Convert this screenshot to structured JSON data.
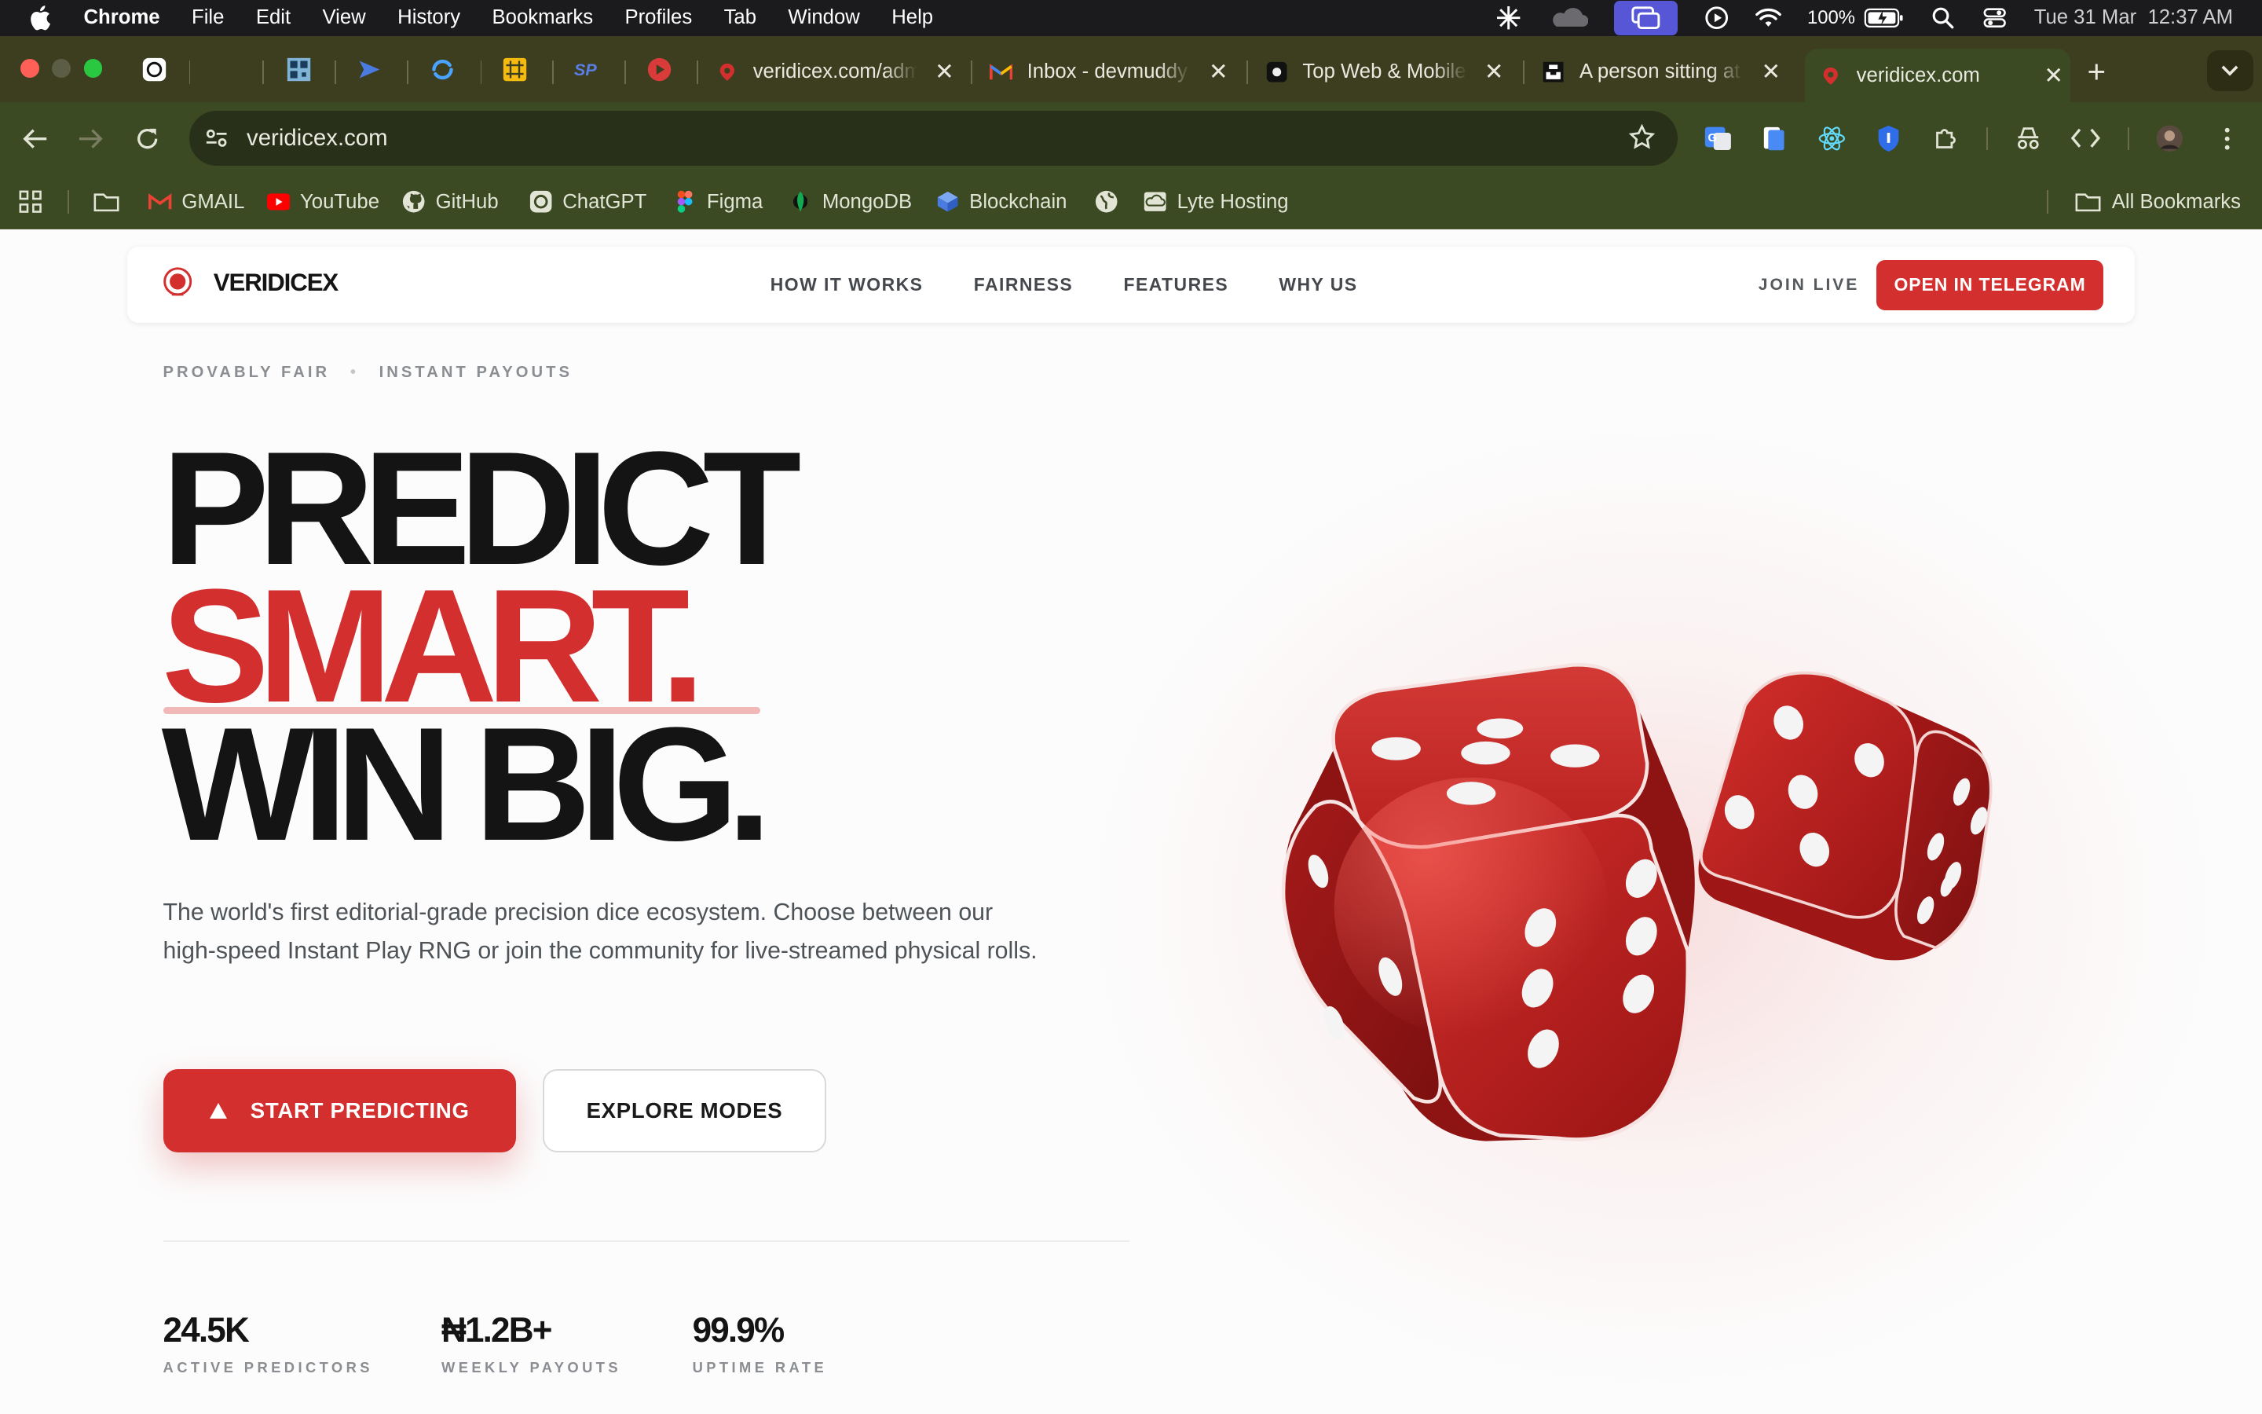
{
  "menubar": {
    "app": "Chrome",
    "items": [
      "File",
      "Edit",
      "View",
      "History",
      "Bookmarks",
      "Profiles",
      "Tab",
      "Window",
      "Help"
    ],
    "battery": "100%",
    "datetime": "Tue 31 Mar  12:37 AM"
  },
  "tabs": [
    {
      "title": "veridicex.com/adm",
      "icon": "veridicex-icon",
      "active": false
    },
    {
      "title": "Inbox - devmuddy",
      "icon": "gmail-icon",
      "active": false
    },
    {
      "title": "Top Web & Mobile",
      "icon": "dribbble-icon",
      "active": false
    },
    {
      "title": "A person sitting at",
      "icon": "unsplash-icon",
      "active": false
    },
    {
      "title": "veridicex.com",
      "icon": "veridicex-icon",
      "active": true
    }
  ],
  "omnibox": {
    "url": "veridicex.com"
  },
  "bookmarks": [
    {
      "label": "GMAIL",
      "icon": "gmail-icon"
    },
    {
      "label": "YouTube",
      "icon": "youtube-icon"
    },
    {
      "label": "GitHub",
      "icon": "github-icon"
    },
    {
      "label": "ChatGPT",
      "icon": "chatgpt-icon"
    },
    {
      "label": "Figma",
      "icon": "figma-icon"
    },
    {
      "label": "MongoDB",
      "icon": "mongodb-icon"
    },
    {
      "label": "Blockchain",
      "icon": "blockchain-icon"
    },
    {
      "label": "",
      "icon": "globe-icon"
    },
    {
      "label": "Lyte Hosting",
      "icon": "cloud-icon"
    }
  ],
  "all_bookmarks": "All Bookmarks",
  "site": {
    "brand": "VERIDICEX",
    "nav": [
      "HOW IT WORKS",
      "FAIRNESS",
      "FEATURES",
      "WHY US"
    ],
    "join_live": "JOIN LIVE",
    "cta_telegram": "OPEN IN TELEGRAM",
    "eyebrow": [
      "PROVABLY FAIR",
      "INSTANT PAYOUTS"
    ],
    "headline": {
      "line1": "PREDICT",
      "line2": "SMART.",
      "line3": "WIN BIG."
    },
    "description": "The world's first editorial-grade precision dice ecosystem. Choose between our high-speed Instant Play RNG or join the community for live-streamed physical rolls.",
    "primary_button": "START PREDICTING",
    "secondary_button": "EXPLORE MODES",
    "stats": [
      {
        "value": "24.5K",
        "label": "ACTIVE PREDICTORS"
      },
      {
        "value": "₦1.2B+",
        "label": "WEEKLY PAYOUTS"
      },
      {
        "value": "99.9%",
        "label": "UPTIME RATE"
      }
    ],
    "accent_color": "#d32f2f"
  }
}
